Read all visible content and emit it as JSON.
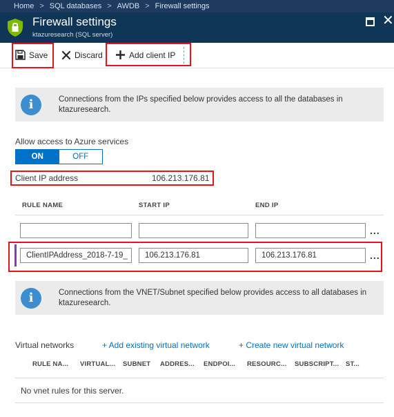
{
  "breadcrumb": {
    "items": [
      {
        "label": "Home"
      },
      {
        "label": "SQL databases"
      },
      {
        "label": "AWDB"
      },
      {
        "label": "Firewall settings"
      }
    ],
    "separator": ">"
  },
  "header": {
    "title": "Firewall settings",
    "subtitle": "ktazuresearch (SQL server)",
    "close_glyph": "✕"
  },
  "toolbar": {
    "save_label": "Save",
    "discard_label": "Discard",
    "add_client_ip_label": "Add client IP"
  },
  "firewall_info": {
    "text": "Connections from the IPs specified below provides access to all the databases in ktazuresearch."
  },
  "azure_services": {
    "label": "Allow access to Azure services",
    "on_label": "ON",
    "off_label": "OFF",
    "selected": "ON"
  },
  "client_ip": {
    "label": "Client IP address",
    "value": "106.213.176.81"
  },
  "rules_table": {
    "headers": [
      "RULE NAME",
      "START IP",
      "END IP"
    ],
    "rows": [
      {
        "rule_name": "",
        "start_ip": "",
        "end_ip": ""
      },
      {
        "rule_name": "ClientIPAddress_2018-7-19_",
        "start_ip": "106.213.176.81",
        "end_ip": "106.213.176.81"
      }
    ],
    "more_glyph": "..."
  },
  "vnet_info": {
    "text": "Connections from the VNET/Subnet specified below provides access to all databases in ktazuresearch."
  },
  "virtual_networks": {
    "label": "Virtual networks",
    "add_existing_label": "+ Add existing virtual network",
    "create_new_label": "+ Create new virtual network",
    "headers": [
      "RULE NA...",
      "VIRTUAL...",
      "SUBNET",
      "ADDRES...",
      "ENDPOI...",
      "RESOURC...",
      "SUBSCRIPT...",
      "ST..."
    ],
    "empty_text": "No vnet rules for this server."
  },
  "colors": {
    "header_bg": "#0f3557",
    "accent": "#0072c6",
    "highlight": "#e8121a",
    "row_marker": "#8b3da6"
  }
}
